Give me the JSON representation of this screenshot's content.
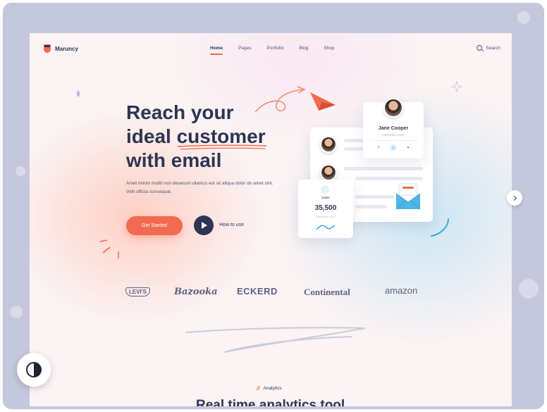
{
  "brand": {
    "name": "Maruncy"
  },
  "nav": {
    "items": [
      {
        "label": "Home",
        "active": true
      },
      {
        "label": "Pages",
        "active": false
      },
      {
        "label": "Portfolio",
        "active": false
      },
      {
        "label": "Blog",
        "active": false
      },
      {
        "label": "Shop",
        "active": false
      }
    ],
    "search_label": "Search"
  },
  "hero": {
    "title_lines": [
      "Reach your",
      "ideal customer",
      "with email"
    ],
    "description": "Amet minim mollit non deserunt ullamco est sit aliqua dolor do amet sint. Velit officia consequat.",
    "cta_label": "Get Started",
    "secondary_label": "How to use"
  },
  "profile_card": {
    "name": "Jane Cooper",
    "role": "Marketing Head",
    "social_icons": [
      "facebook-icon",
      "instagram-icon",
      "twitter-icon"
    ]
  },
  "sales_card": {
    "label": "Sales",
    "value": "35,500",
    "sublabel": "Increased 11%"
  },
  "logos": [
    "LEVI'S",
    "Bazooka",
    "ECKERD",
    "Continental",
    "amazon"
  ],
  "analytics": {
    "tag": "Analytics",
    "title": "Real time analytics tool"
  },
  "colors": {
    "accent": "#f26a4f",
    "navy": "#2d3553",
    "frame": "#c5c7dc"
  }
}
